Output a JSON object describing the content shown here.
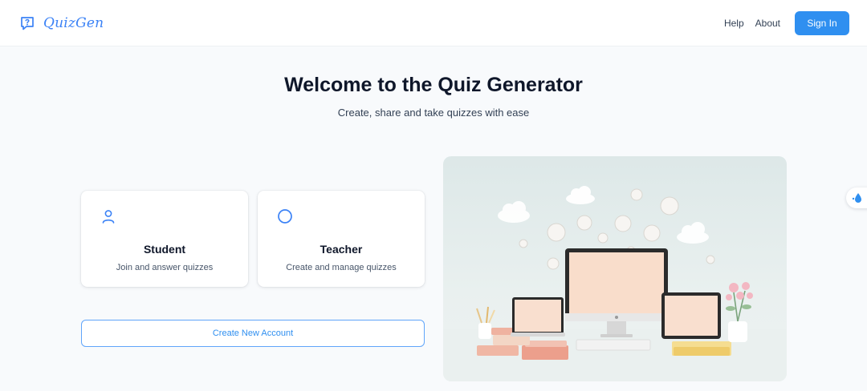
{
  "header": {
    "brand": "QuizGen",
    "nav": {
      "help": "Help",
      "about": "About"
    },
    "signin_label": "Sign In"
  },
  "hero": {
    "title": "Welcome to the Quiz Generator",
    "subtitle": "Create, share and take quizzes with ease"
  },
  "roles": [
    {
      "title": "Student",
      "description": "Join and answer quizzes",
      "icon": "user-icon"
    },
    {
      "title": "Teacher",
      "description": "Create and manage quizzes",
      "icon": "circle-icon"
    }
  ],
  "create_account_label": "Create New Account",
  "colors": {
    "accent": "#2f8ff0",
    "brand": "#3b82f6",
    "heading": "#0f172a",
    "background": "#f8fafc"
  },
  "icons": {
    "logo": "question-bubble-icon",
    "widget": "water-drop-icon"
  }
}
